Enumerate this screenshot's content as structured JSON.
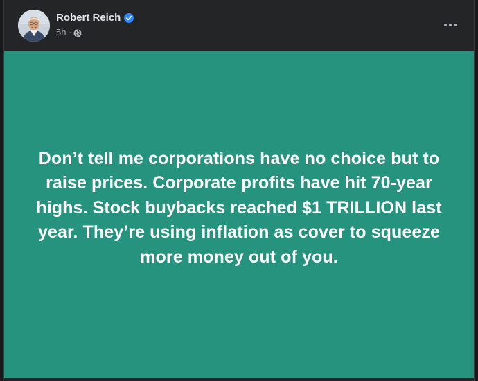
{
  "post": {
    "author": "Robert Reich",
    "timestamp": "5h ·",
    "audience_icon": "globe-icon",
    "verified_icon": "verified-badge-icon",
    "menu_icon": "more-options-icon",
    "card_background": "#26937F",
    "body_text": "Don’t tell me corporations have no choice but to raise prices. Corporate profits have hit 70-year highs. Stock buybacks reached $1 TRILLION last year. They’re using inflation as cover to squeeze more money out of you."
  },
  "colors": {
    "page_bg": "#18191a",
    "post_bg": "#242526",
    "verified_blue": "#2d88ff",
    "text_primary": "#e4e6eb",
    "text_secondary": "#b0b3b8"
  }
}
